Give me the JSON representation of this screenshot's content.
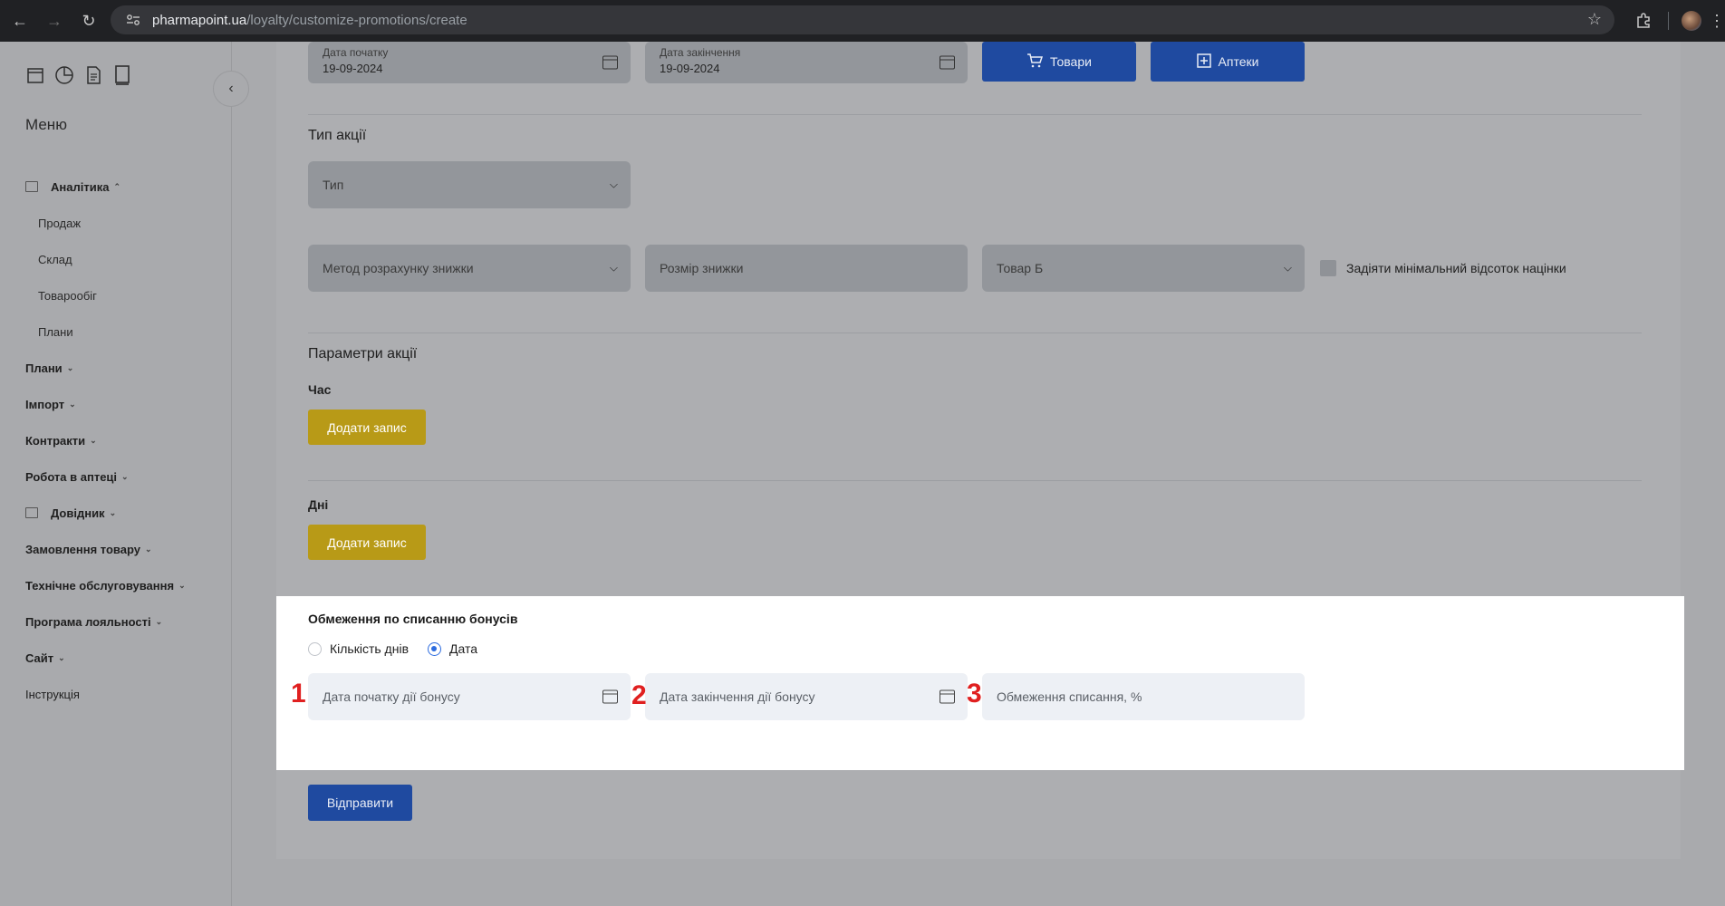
{
  "browser": {
    "url_host": "pharmapoint.ua",
    "url_path": "/loyalty/customize-promotions/create"
  },
  "sidebar": {
    "menu_title": "Меню",
    "items": [
      {
        "label": "Аналітика",
        "icon": "table-icon",
        "expanded": true
      },
      {
        "label": "Продаж",
        "sub": true
      },
      {
        "label": "Склад",
        "sub": true
      },
      {
        "label": "Товарообіг",
        "sub": true
      },
      {
        "label": "Плани",
        "sub": true
      },
      {
        "label": "Плани"
      },
      {
        "label": "Імпорт"
      },
      {
        "label": "Контракти"
      },
      {
        "label": "Робота в аптеці"
      },
      {
        "label": "Довідник",
        "icon": "list-icon"
      },
      {
        "label": "Замовлення товару"
      },
      {
        "label": "Технічне обслуговування"
      },
      {
        "label": "Програма лояльності"
      },
      {
        "label": "Сайт"
      },
      {
        "label": "Інструкція",
        "plain": true
      }
    ]
  },
  "form": {
    "start_date_label": "Дата початку",
    "start_date_value": "19-09-2024",
    "end_date_label": "Дата закінчення",
    "end_date_value": "19-09-2024",
    "goods_button": "Товари",
    "pharmacies_button": "Аптеки",
    "promo_type_heading": "Тип акції",
    "type_select": "Тип",
    "discount_method_select": "Метод розрахунку знижки",
    "discount_size_input": "Розмір знижки",
    "product_b_select": "Товар Б",
    "min_markup_checkbox": "Задіяти мінімальний відсоток націнки",
    "params_heading": "Параметри акції",
    "time_label": "Час",
    "add_record_time": "Додати запис",
    "days_label": "Дні",
    "add_record_days": "Додати запис",
    "submit_button": "Відправити"
  },
  "bonus_panel": {
    "title": "Обмеження по списанню бонусів",
    "radio_days": "Кількість днів",
    "radio_date": "Дата",
    "selected": "Дата",
    "bonus_start_placeholder": "Дата початку дії бонусу",
    "bonus_end_placeholder": "Дата закінчення дії бонусу",
    "limit_placeholder": "Обмеження списання, %",
    "markers": [
      "1",
      "2",
      "3"
    ]
  },
  "colors": {
    "overlay_gray": "#a9aaad",
    "primary_blue": "#1f4aa0",
    "yellow": "#b89a17",
    "marker_red": "#e02020",
    "radio_blue": "#2d6cdf"
  }
}
